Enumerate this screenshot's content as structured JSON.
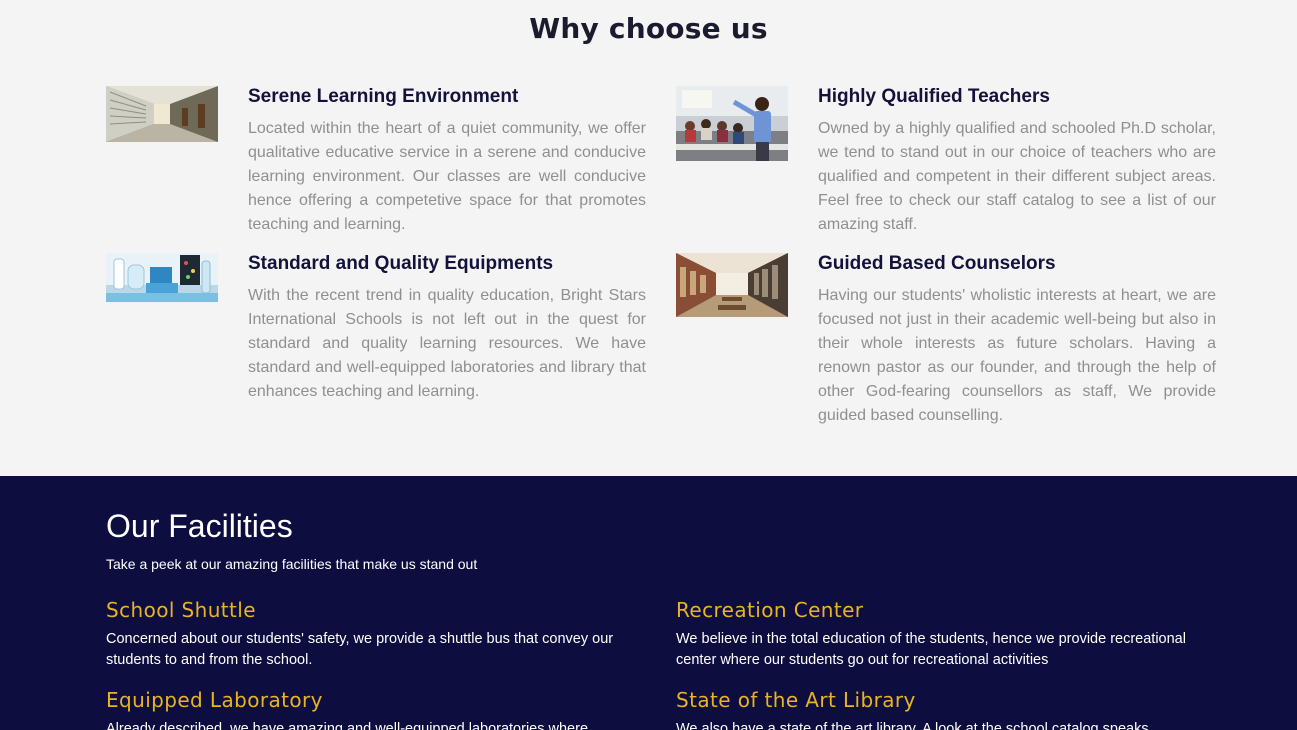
{
  "why": {
    "title": "Why choose us",
    "features": [
      {
        "title": "Serene Learning Environment",
        "text": "Located within the heart of a quiet community, we offer qualitative educative service in a serene and conducive learning environment. Our classes are well conducive hence offering a competetive space for that promotes teaching and learning.",
        "image": "hallway-photo"
      },
      {
        "title": "Highly Qualified Teachers",
        "text": "Owned by a highly qualified and schooled Ph.D scholar, we tend to stand out in our choice of teachers who are qualified and competent in their different subject areas. Feel free to check our staff catalog to see a list of our amazing staff.",
        "image": "classroom-teacher-photo"
      },
      {
        "title": "Standard and Quality Equipments",
        "text": "With the recent trend in quality education, Bright Stars International Schools is not left out in the quest for standard and quality learning resources. We have standard and well-equipped laboratories and library that enhances teaching and learning.",
        "image": "laboratory-photo"
      },
      {
        "title": "Guided Based Counselors",
        "text": "Having our students' wholistic interests at heart, we are focused not just in their academic well-being but also in their whole interests as future scholars. Having a renown pastor as our founder, and through the help of other God-fearing counsellors as staff, We provide guided based counselling.",
        "image": "library-photo"
      }
    ]
  },
  "facilities": {
    "title": "Our Facilities",
    "subtitle": "Take a peek at our amazing facilities that make us stand out",
    "items": [
      {
        "title": "School Shuttle",
        "text": "Concerned about our students' safety, we provide a shuttle bus that convey our students to and from the school."
      },
      {
        "title": "Recreation Center",
        "text": "We believe in the total education of the students, hence we provide recreational center where our students go out for recreational activities"
      },
      {
        "title": "Equipped Laboratory",
        "text": "Already described, we have amazing and well-equipped laboratories where students"
      },
      {
        "title": "State of the Art Library",
        "text": "We also have a state of the art library. A look at the school catalog speaks volume"
      }
    ]
  },
  "colors": {
    "background": "#f4f4f4",
    "heading": "#12123a",
    "body_text": "#8f8f8f",
    "facilities_bg": "#0d0d40",
    "accent_gold": "#e8b420"
  }
}
